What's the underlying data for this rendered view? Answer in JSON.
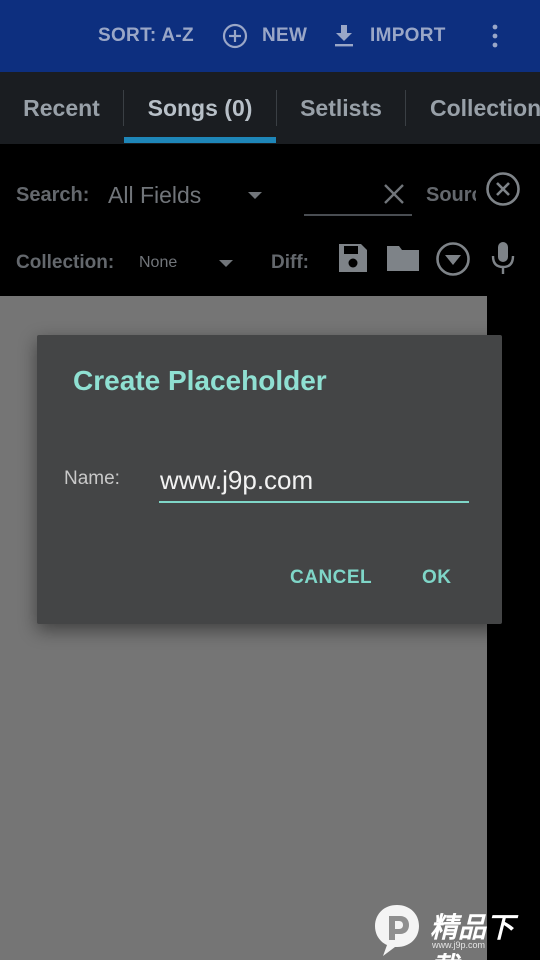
{
  "topbar": {
    "sort_label": "SORT: A-Z",
    "new_label": "NEW",
    "import_label": "IMPORT",
    "icons": [
      "add-circle-icon",
      "download-icon",
      "overflow-menu-icon"
    ],
    "background": "#0d2f7f"
  },
  "tabs": [
    {
      "label": "Recent",
      "active": false
    },
    {
      "label": "Songs (0)",
      "active": true
    },
    {
      "label": "Setlists",
      "active": false
    },
    {
      "label": "Collections",
      "active": false
    }
  ],
  "filters": {
    "search_label": "Search:",
    "search_field_value": "All Fields",
    "search_input_value": "",
    "source_label": "Source",
    "collection_label": "Collection:",
    "collection_value": "None",
    "diff_label": "Diff:",
    "icons": [
      "clear-icon",
      "close-circle-icon",
      "save-icon",
      "folder-icon",
      "dropdown-circle-icon",
      "microphone-icon"
    ]
  },
  "dialog": {
    "title": "Create Placeholder",
    "name_label": "Name:",
    "name_value": "www.j9p.com",
    "cancel_label": "CANCEL",
    "ok_label": "OK",
    "accent": "#7fd6c8"
  },
  "watermark": {
    "text": "精品下载",
    "subtext": "www.j9p.com"
  }
}
